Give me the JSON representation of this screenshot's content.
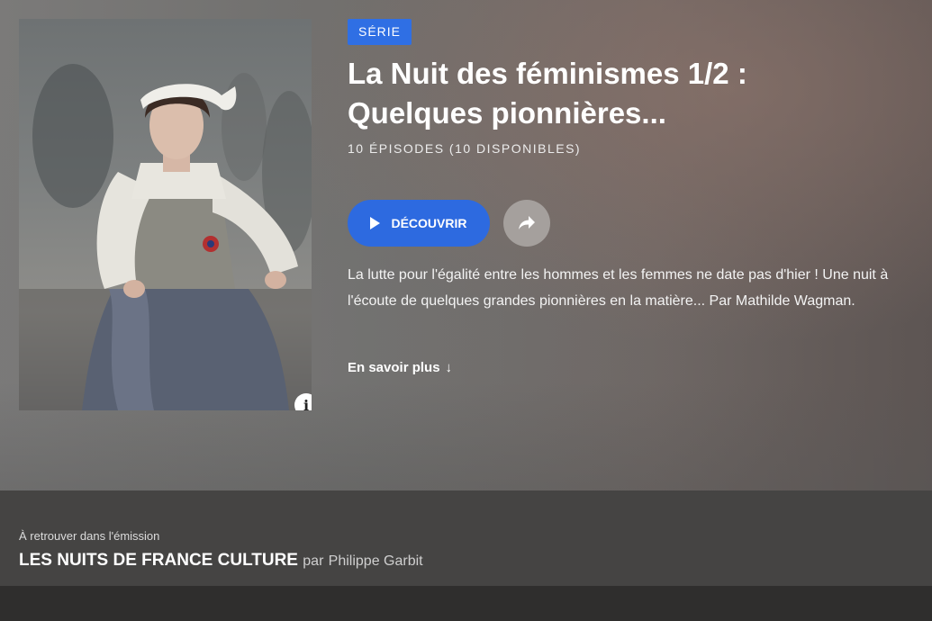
{
  "poster": {
    "info_label": "i"
  },
  "badge": "SÉRIE",
  "title": "La Nuit des féminismes 1/2 : Quelques pionnières...",
  "episodes": "10 ÉPISODES (10 DISPONIBLES)",
  "actions": {
    "discover_label": "DÉCOUVRIR",
    "accent_color": "#2d6ae0"
  },
  "description": "La lutte pour l'égalité entre les hommes et les femmes ne date pas d'hier ! Une nuit à l'écoute de quelques grandes pionnières en la matière... Par Mathilde Wagman.",
  "more_label": "En savoir plus",
  "more_arrow": "↓",
  "show": {
    "find_label": "À retrouver dans l'émission",
    "name": "LES NUITS DE FRANCE CULTURE",
    "by": "par",
    "host": "Philippe Garbit"
  }
}
